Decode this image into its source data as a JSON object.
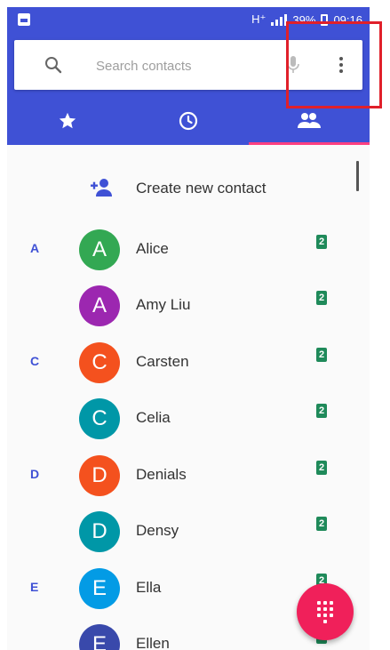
{
  "status": {
    "network": "H⁺",
    "battery": "39%",
    "time": "09:16"
  },
  "search": {
    "placeholder": "Search contacts"
  },
  "tabs": [
    {
      "icon": "star-icon",
      "label": "Favorites"
    },
    {
      "icon": "clock-icon",
      "label": "Recents"
    },
    {
      "icon": "people-icon",
      "label": "Contacts",
      "active": true
    }
  ],
  "create_contact": {
    "label": "Create new contact"
  },
  "contacts": [
    {
      "letter": "A",
      "initial": "A",
      "name": "Alice",
      "color": "#33a853"
    },
    {
      "letter": "",
      "initial": "A",
      "name": "Amy Liu",
      "color": "#9c27b0"
    },
    {
      "letter": "C",
      "initial": "C",
      "name": "Carsten",
      "color": "#f4511e"
    },
    {
      "letter": "",
      "initial": "C",
      "name": "Celia",
      "color": "#0097a7"
    },
    {
      "letter": "D",
      "initial": "D",
      "name": "Denials",
      "color": "#f4511e"
    },
    {
      "letter": "",
      "initial": "D",
      "name": "Densy",
      "color": "#0097a7"
    },
    {
      "letter": "E",
      "initial": "E",
      "name": "Ella",
      "color": "#039be5"
    },
    {
      "letter": "",
      "initial": "E",
      "name": "Ellen",
      "color": "#3949ab"
    }
  ],
  "sim_badge": "2",
  "colors": {
    "appbar": "#3f51d5",
    "accent": "#ff4081",
    "fab": "#f0205a",
    "highlight": "#e0202a"
  }
}
